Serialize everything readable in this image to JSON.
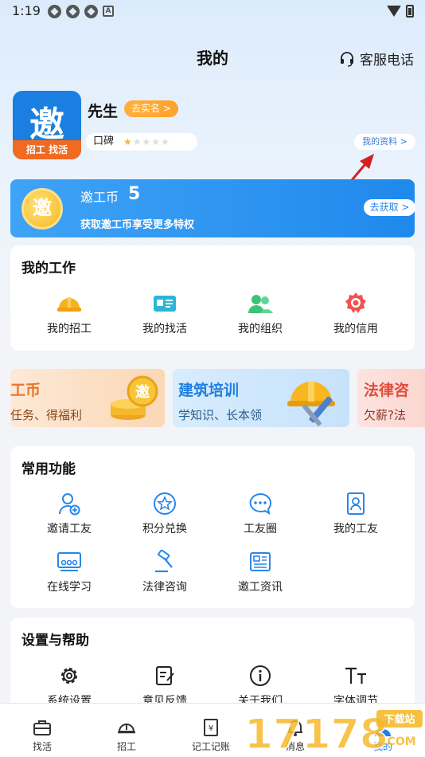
{
  "status_bar": {
    "time": "1:19"
  },
  "header": {
    "title": "我的",
    "service_label": "客服电话"
  },
  "profile": {
    "app_logo_char": "邀",
    "app_logo_strip": "招工 找活",
    "name": "先生",
    "verify_label": "去实名 >",
    "reputation_label": "口碑",
    "reputation_stars": 1,
    "reputation_max": 5,
    "my_data_label": "我的资料 >"
  },
  "coin_banner": {
    "logo_char": "邀",
    "title": "邀工币",
    "count": "5",
    "subtitle": "获取邀工币享受更多特权",
    "get_label": "去获取 >"
  },
  "my_work": {
    "title": "我的工作",
    "items": [
      {
        "label": "我的招工",
        "icon": "helmet-icon"
      },
      {
        "label": "我的找活",
        "icon": "id-card-icon"
      },
      {
        "label": "我的组织",
        "icon": "group-icon"
      },
      {
        "label": "我的信用",
        "icon": "medal-icon"
      }
    ]
  },
  "promos": [
    {
      "title": "工币",
      "subtitle": "任务、得福利"
    },
    {
      "title": "建筑培训",
      "subtitle": "学知识、长本领"
    },
    {
      "title": "法律咨",
      "subtitle": "欠薪?法"
    }
  ],
  "common": {
    "title": "常用功能",
    "items": [
      {
        "label": "邀请工友",
        "icon": "invite-user-icon"
      },
      {
        "label": "积分兑换",
        "icon": "star-badge-icon"
      },
      {
        "label": "工友圈",
        "icon": "chat-bubble-icon"
      },
      {
        "label": "我的工友",
        "icon": "contact-book-icon"
      },
      {
        "label": "在线学习",
        "icon": "online-learning-icon"
      },
      {
        "label": "法律咨询",
        "icon": "gavel-icon"
      },
      {
        "label": "邀工资讯",
        "icon": "news-icon"
      }
    ]
  },
  "settings": {
    "title": "设置与帮助",
    "items": [
      {
        "label": "系统设置",
        "icon": "gear-icon"
      },
      {
        "label": "意见反馈",
        "icon": "feedback-icon"
      },
      {
        "label": "关于我们",
        "icon": "info-icon"
      },
      {
        "label": "字体调节",
        "icon": "font-size-icon"
      }
    ]
  },
  "tabbar": {
    "tabs": [
      {
        "label": "找活",
        "icon": "briefcase-icon"
      },
      {
        "label": "招工",
        "icon": "helmet-icon"
      },
      {
        "label": "记工记账",
        "icon": "ledger-icon"
      },
      {
        "label": "消息",
        "icon": "bell-icon"
      },
      {
        "label": "我的",
        "icon": "person-icon"
      }
    ]
  },
  "watermark": {
    "text": "17178",
    "badge": "下载站",
    "suffix": ".COM"
  }
}
